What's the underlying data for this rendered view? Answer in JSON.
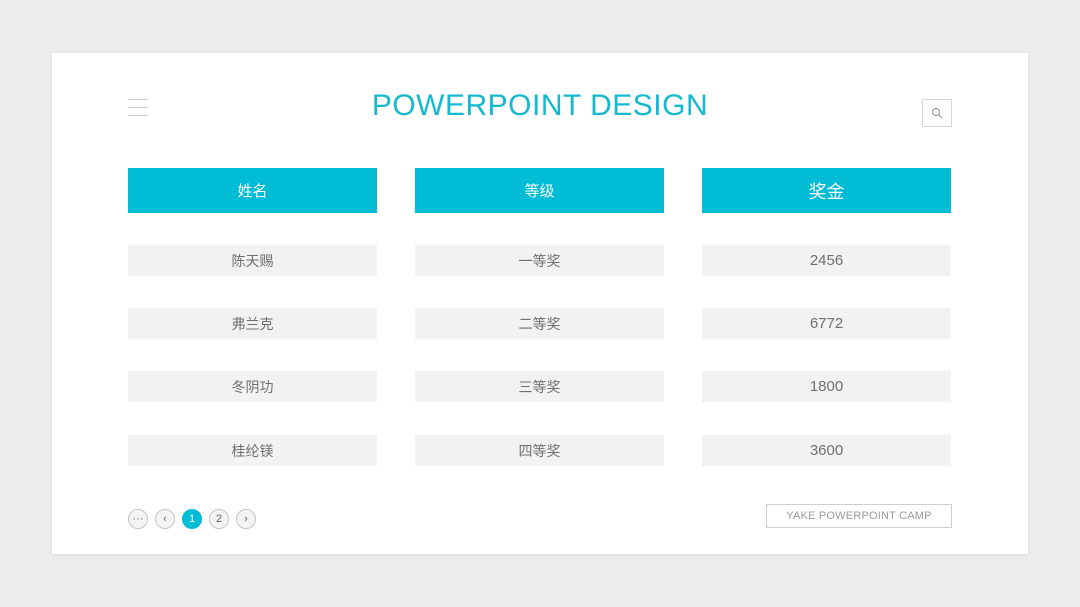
{
  "title": "POWERPOINT DESIGN",
  "icons": {
    "menu": "hamburger-menu-icon",
    "search": "search-icon"
  },
  "colors": {
    "accent": "#00bcd4",
    "title": "#14b8cf",
    "cell_bg": "#f2f2f3",
    "page_bg": "#ececee"
  },
  "table": {
    "columns": [
      "姓名",
      "等级",
      "奖金"
    ],
    "rows": [
      [
        "陈天赐",
        "一等奖",
        "2456"
      ],
      [
        "弗兰克",
        "二等奖",
        "6772"
      ],
      [
        "冬阴功",
        "三等奖",
        "1800"
      ],
      [
        "桂纶镁",
        "四等奖",
        "3600"
      ]
    ]
  },
  "pagination": {
    "ellipsis": "···",
    "prev": "‹",
    "pages": [
      "1",
      "2"
    ],
    "current": "1",
    "next": "›"
  },
  "brand_label": "YAKE POWERPOINT CAMP"
}
